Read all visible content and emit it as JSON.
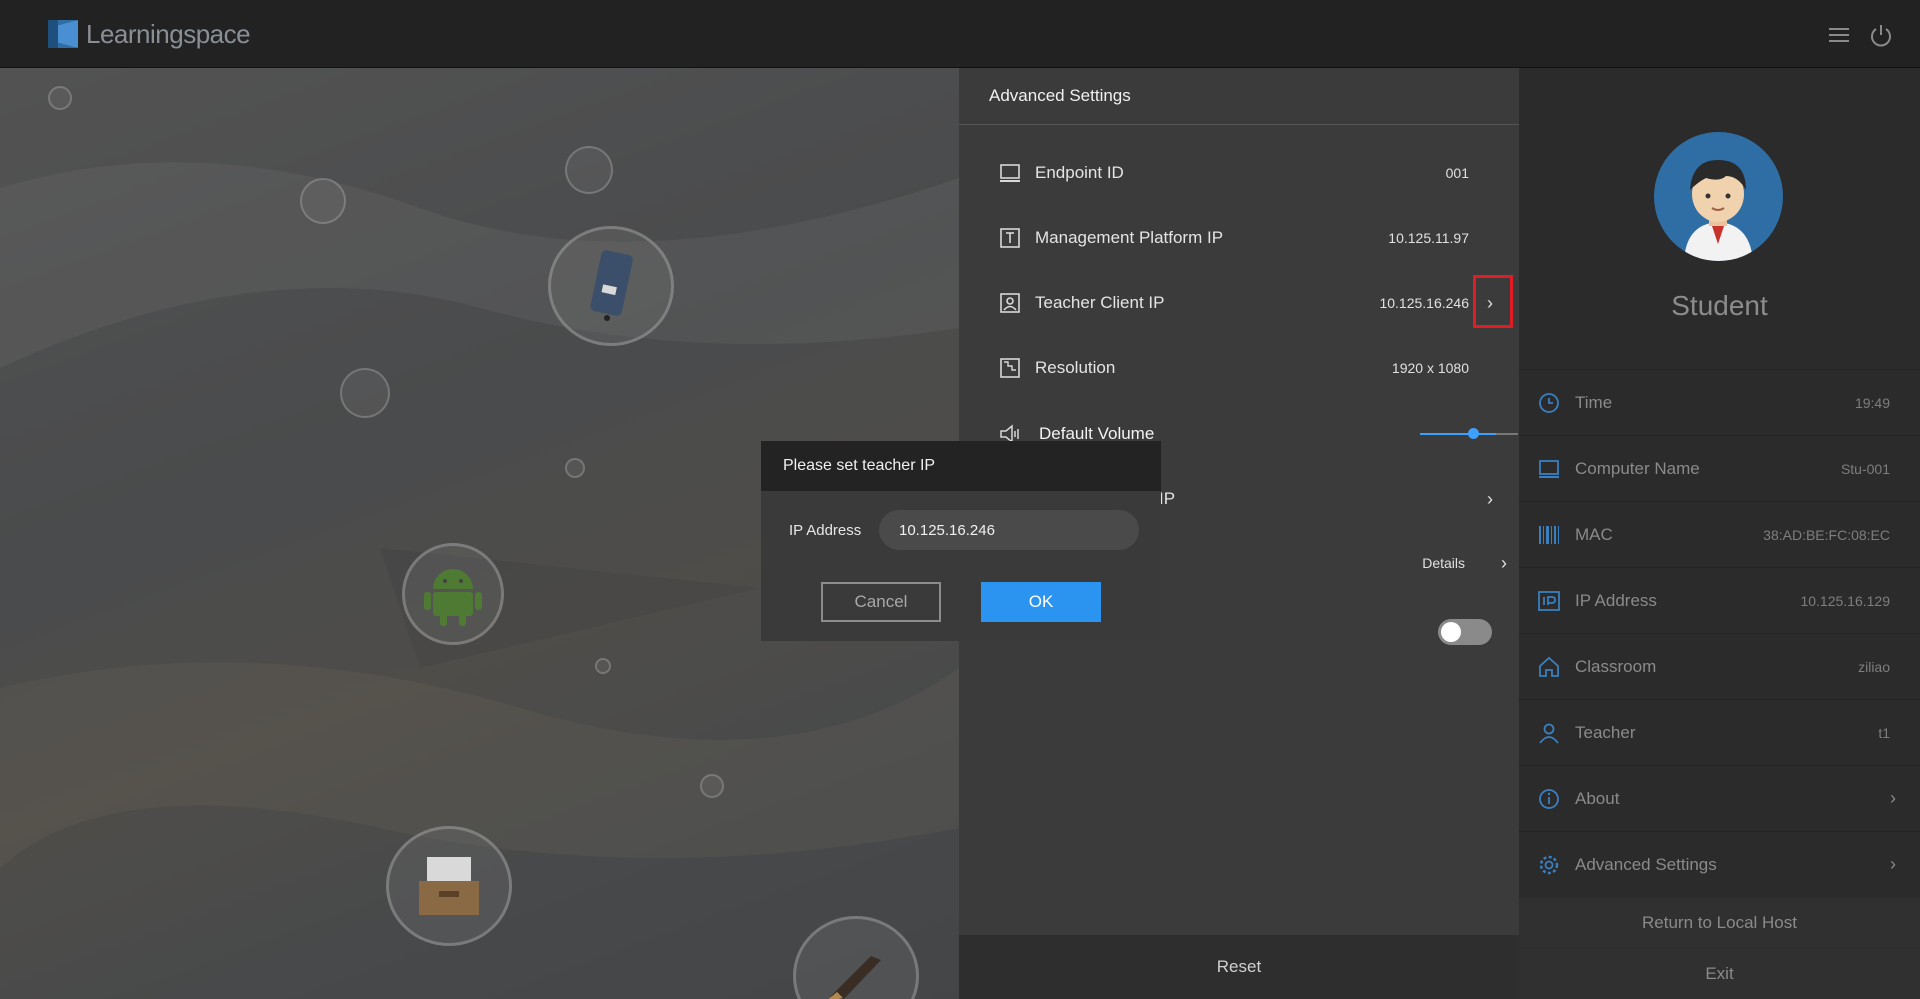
{
  "app": {
    "title": "Learningspace"
  },
  "topbar": {
    "menu_icon": "hamburger-menu-icon",
    "power_icon": "power-icon"
  },
  "settings": {
    "title": "Advanced Settings",
    "rows": [
      {
        "label": "Endpoint ID",
        "value": "001",
        "icon": "monitor-icon"
      },
      {
        "label": "Management Platform IP",
        "value": "10.125.11.97",
        "icon": "platform-icon"
      },
      {
        "label": "Teacher Client IP",
        "value": "10.125.16.246",
        "icon": "teacher-client-icon",
        "chevron": "›"
      },
      {
        "label": "Resolution",
        "value": "1920 x 1080",
        "icon": "resolution-icon"
      },
      {
        "label": "Default Volume",
        "icon": "speaker-icon",
        "volume": 0.8
      },
      {
        "label": "IP",
        "chevron": "›"
      },
      {
        "value": "Details",
        "chevron": "›"
      }
    ],
    "toggle_on": false,
    "reset_label": "Reset"
  },
  "dialog": {
    "title": "Please set teacher IP",
    "field_label": "IP Address",
    "field_value": "10.125.16.246",
    "cancel_label": "Cancel",
    "ok_label": "OK"
  },
  "profile": {
    "name": "Student",
    "rows": [
      {
        "label": "Time",
        "value": "19:49",
        "icon": "clock-icon"
      },
      {
        "label": "Computer Name",
        "value": "Stu-001",
        "icon": "computer-icon"
      },
      {
        "label": "MAC",
        "value": "38:AD:BE:FC:08:EC",
        "icon": "barcode-icon"
      },
      {
        "label": "IP Address",
        "value": "10.125.16.129",
        "icon": "ip-icon"
      },
      {
        "label": "Classroom",
        "value": "ziliao",
        "icon": "home-icon"
      },
      {
        "label": "Teacher",
        "value": "t1",
        "icon": "person-icon"
      },
      {
        "label": "About",
        "chevron": "›",
        "icon": "info-icon"
      },
      {
        "label": "Advanced Settings",
        "chevron": "›",
        "icon": "gear-icon"
      }
    ],
    "return_label": "Return to Local Host",
    "exit_label": "Exit"
  },
  "colors": {
    "accent": "#2b93f0",
    "highlight": "#e01c24",
    "avatar_bg": "#2f6ea5"
  }
}
